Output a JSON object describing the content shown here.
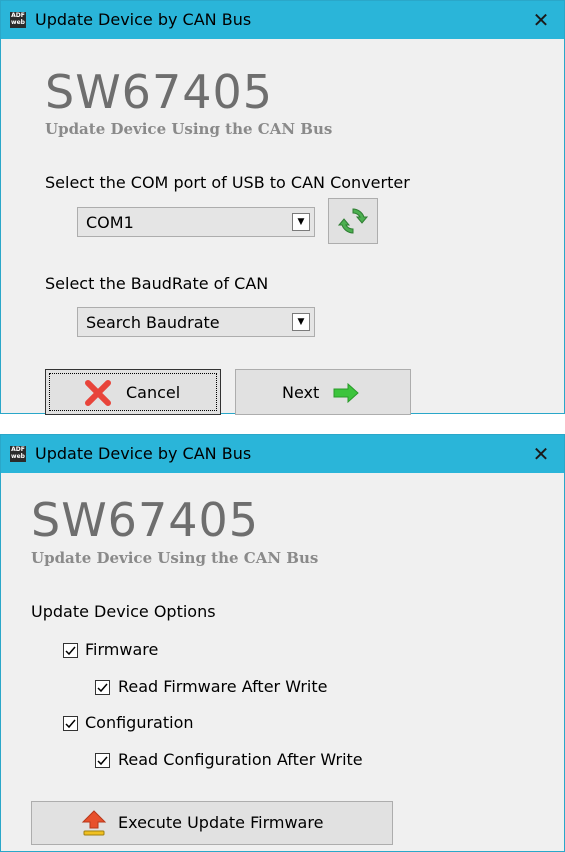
{
  "window1": {
    "title": "Update Device by CAN Bus",
    "app_icon_text": "ADF web",
    "close_label": "✕",
    "product_code": "SW67405",
    "subtitle": "Update Device Using the CAN Bus",
    "com_port_label": "Select the COM port of USB to CAN Converter",
    "com_port_value": "COM1",
    "baudrate_label": "Select the BaudRate of CAN",
    "baudrate_value": "Search Baudrate",
    "cancel_label": "Cancel",
    "next_label": "Next"
  },
  "window2": {
    "title": "Update Device by CAN Bus",
    "app_icon_text": "ADF web",
    "close_label": "✕",
    "product_code": "SW67405",
    "subtitle": "Update Device Using the CAN Bus",
    "options_label": "Update Device Options",
    "options": [
      {
        "label": "Firmware",
        "checked": true
      },
      {
        "label": "Read Firmware After Write",
        "checked": true
      },
      {
        "label": "Configuration",
        "checked": true
      },
      {
        "label": "Read Configuration After Write",
        "checked": true
      }
    ],
    "execute_label": "Execute Update Firmware"
  },
  "colors": {
    "titlebar": "#2ab5d9",
    "cancel_icon": "#e8443a",
    "next_arrow": "#3cc43c",
    "refresh_icon": "#4caf50",
    "upload_icon": "#e8502c"
  }
}
